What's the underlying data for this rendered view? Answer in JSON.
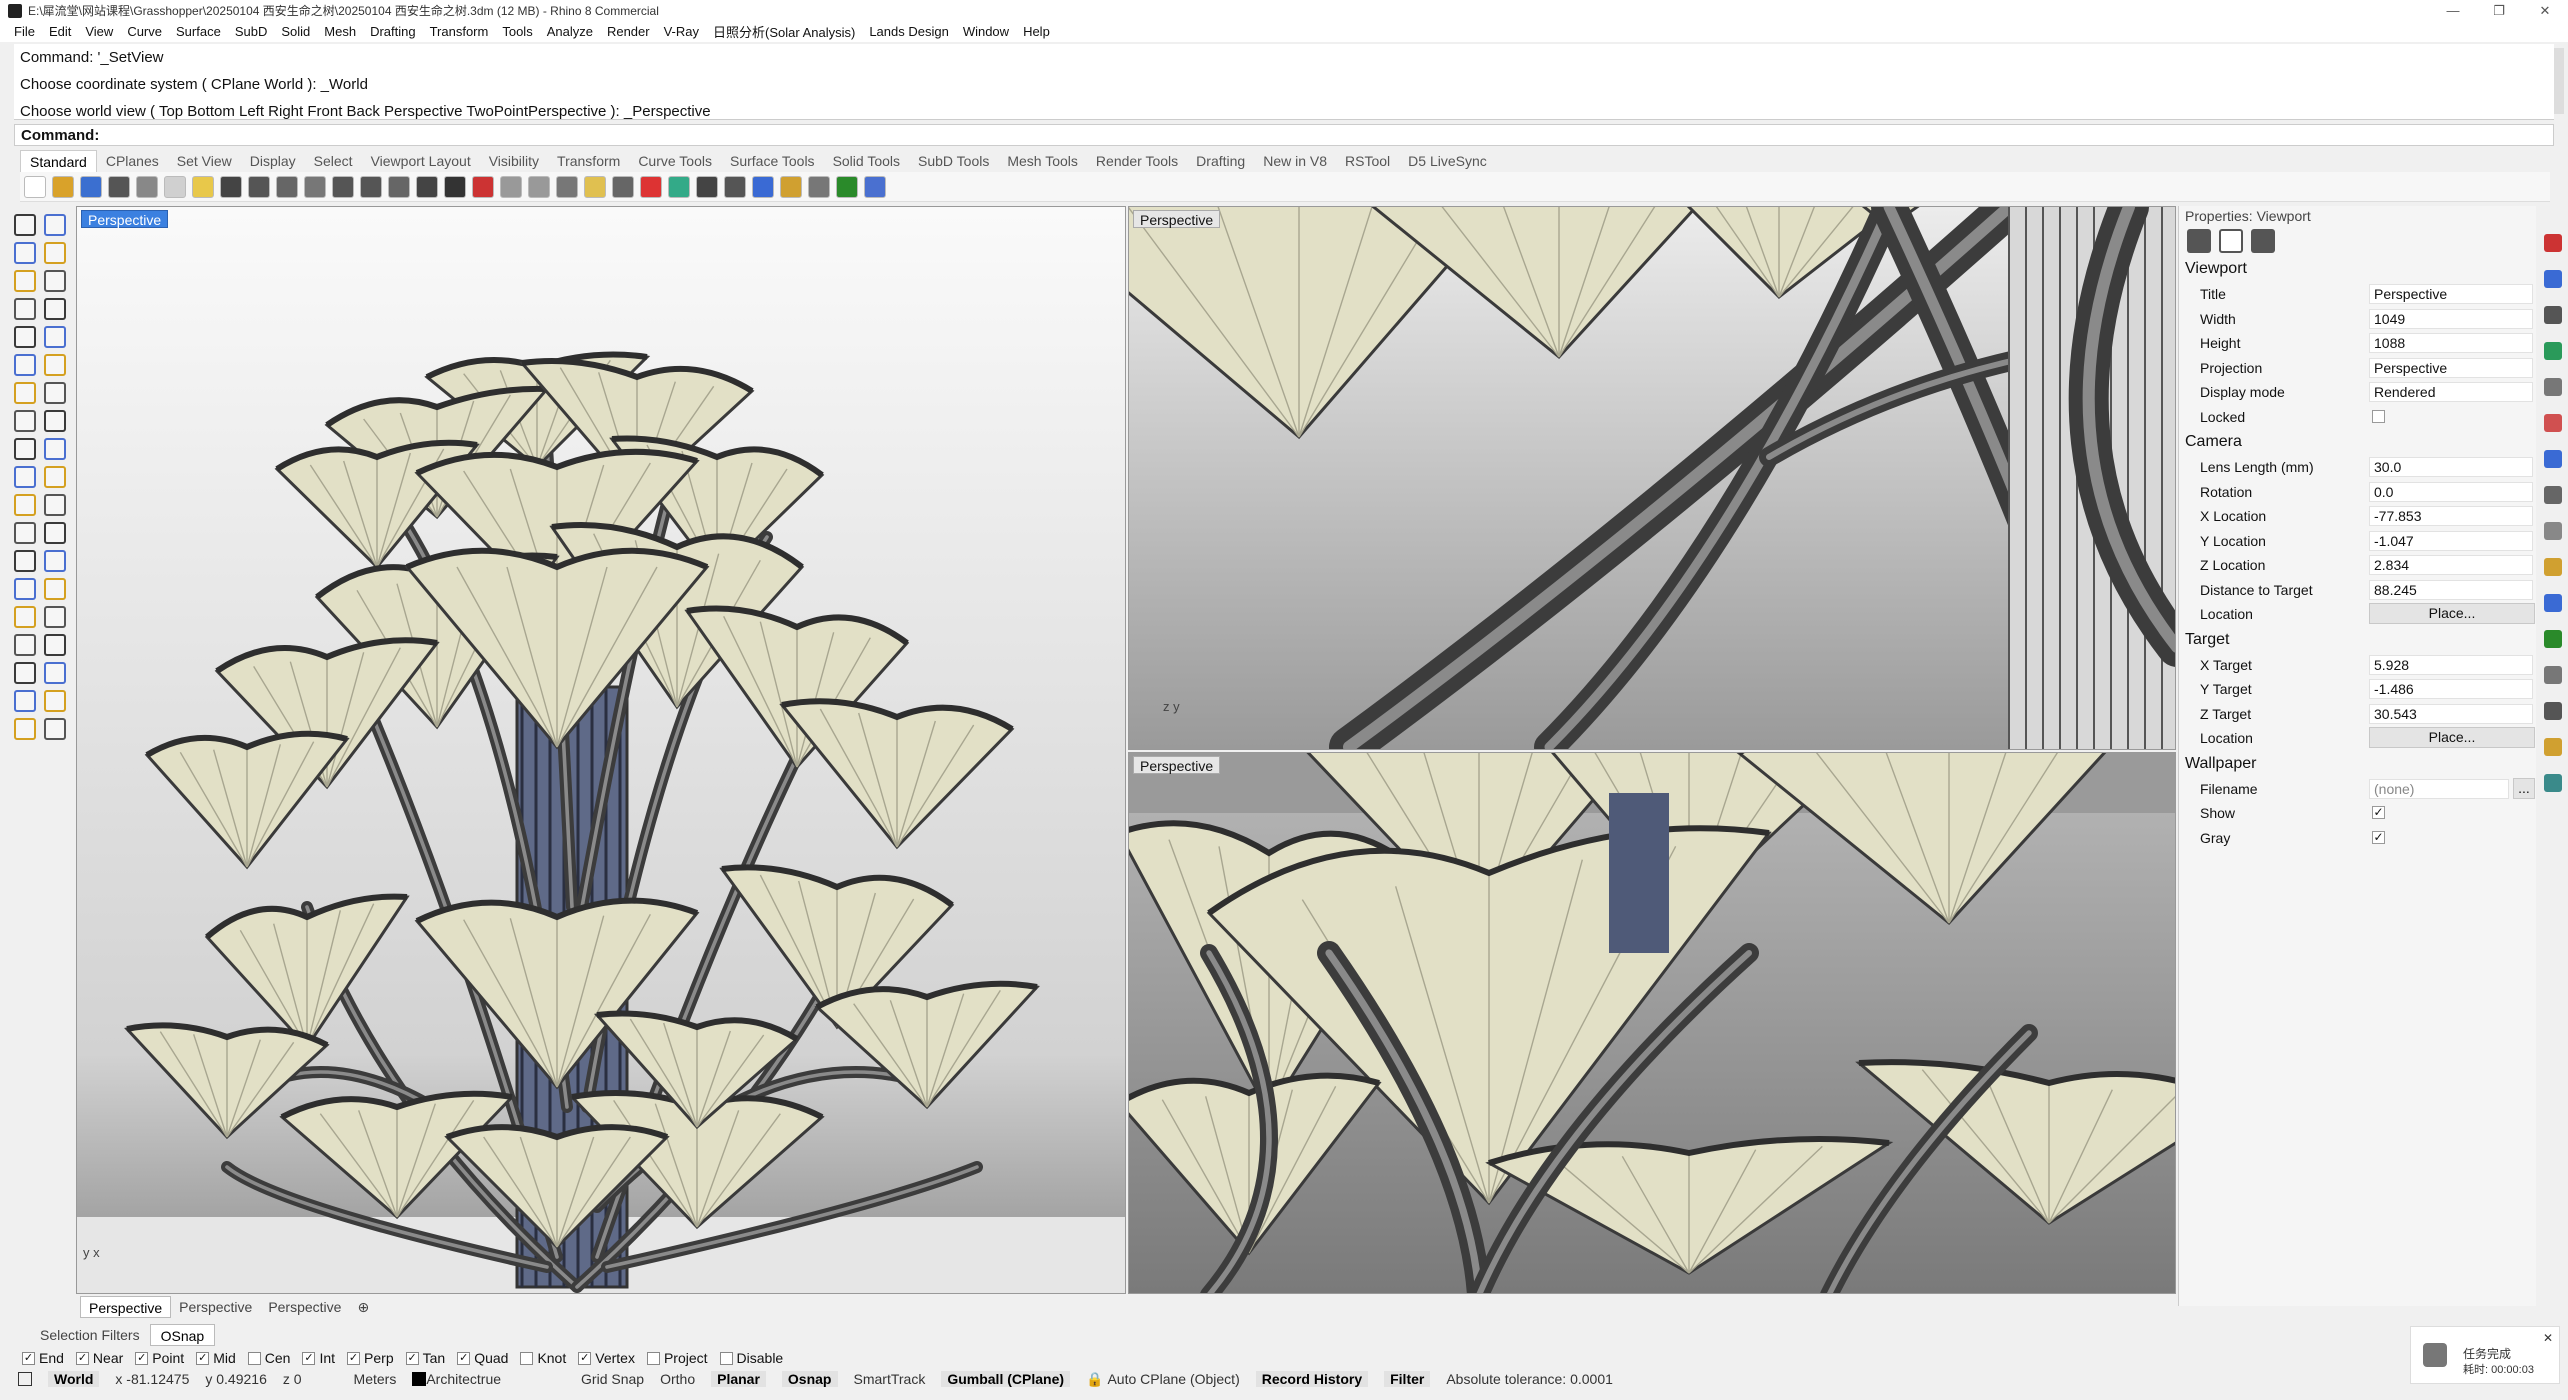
{
  "title": "E:\\犀流堂\\网站课程\\Grasshopper\\20250104 西安生命之树\\20250104 西安生命之树.3dm (12 MB) - Rhino 8 Commercial",
  "menu": [
    "File",
    "Edit",
    "View",
    "Curve",
    "Surface",
    "SubD",
    "Solid",
    "Mesh",
    "Drafting",
    "Transform",
    "Tools",
    "Analyze",
    "Render",
    "V-Ray",
    "日照分析(Solar Analysis)",
    "Lands Design",
    "Window",
    "Help"
  ],
  "command_history": [
    "Command: '_SetView",
    "Choose coordinate system ( CPlane  World ): _World",
    "Choose world view ( Top  Bottom  Left  Right  Front  Back  Perspective  TwoPointPerspective ): _Perspective"
  ],
  "command_prompt": "Command:",
  "toolbar_tabs": [
    "Standard",
    "CPlanes",
    "Set View",
    "Display",
    "Select",
    "Viewport Layout",
    "Visibility",
    "Transform",
    "Curve Tools",
    "Surface Tools",
    "Solid Tools",
    "SubD Tools",
    "Mesh Tools",
    "Render Tools",
    "Drafting",
    "New in V8",
    "RSTool",
    "D5 LiveSync"
  ],
  "viewports": {
    "main_label": "Perspective",
    "top_right_label": "Perspective",
    "bottom_right_label": "Perspective",
    "main_axis": "y x",
    "tr_axis": "z y"
  },
  "viewport_tabs": [
    "Perspective",
    "Perspective",
    "Perspective"
  ],
  "properties": {
    "title": "Properties: Viewport",
    "viewport_section": "Viewport",
    "rows_viewport": [
      {
        "k": "Title",
        "v": "Perspective"
      },
      {
        "k": "Width",
        "v": "1049"
      },
      {
        "k": "Height",
        "v": "1088"
      },
      {
        "k": "Projection",
        "v": "Perspective"
      },
      {
        "k": "Display mode",
        "v": "Rendered"
      }
    ],
    "locked_label": "Locked",
    "camera_section": "Camera",
    "rows_camera": [
      {
        "k": "Lens Length (mm)",
        "v": "30.0"
      },
      {
        "k": "Rotation",
        "v": "0.0"
      },
      {
        "k": "X Location",
        "v": "-77.853"
      },
      {
        "k": "Y Location",
        "v": "-1.047"
      },
      {
        "k": "Z Location",
        "v": "2.834"
      },
      {
        "k": "Distance to Target",
        "v": "88.245"
      }
    ],
    "location_label": "Location",
    "place_button": "Place...",
    "target_section": "Target",
    "rows_target": [
      {
        "k": "X Target",
        "v": "5.928"
      },
      {
        "k": "Y Target",
        "v": "-1.486"
      },
      {
        "k": "Z Target",
        "v": "30.543"
      }
    ],
    "wallpaper_section": "Wallpaper",
    "filename_label": "Filename",
    "filename_value": "(none)",
    "browse": "...",
    "show_label": "Show",
    "gray_label": "Gray",
    "check": "✓"
  },
  "filters": [
    "Selection Filters",
    "OSnap"
  ],
  "osnap": [
    {
      "label": "End",
      "checked": true
    },
    {
      "label": "Near",
      "checked": true
    },
    {
      "label": "Point",
      "checked": true
    },
    {
      "label": "Mid",
      "checked": true
    },
    {
      "label": "Cen",
      "checked": false
    },
    {
      "label": "Int",
      "checked": true
    },
    {
      "label": "Perp",
      "checked": true
    },
    {
      "label": "Tan",
      "checked": true
    },
    {
      "label": "Quad",
      "checked": true
    },
    {
      "label": "Knot",
      "checked": false
    },
    {
      "label": "Vertex",
      "checked": true
    },
    {
      "label": "Project",
      "checked": false
    },
    {
      "label": "Disable",
      "checked": false
    }
  ],
  "status": {
    "cplane": "World",
    "x": "x -81.12475",
    "y": "y 0.49216",
    "z": "z 0",
    "units": "Meters",
    "layer": "Architectrue",
    "grid_snap": "Grid Snap",
    "ortho": "Ortho",
    "planar": "Planar",
    "osnap": "Osnap",
    "smarttrack": "SmartTrack",
    "gumball": "Gumball (CPlane)",
    "auto_cplane": "Auto CPlane (Object)",
    "record_history": "Record History",
    "filter": "Filter",
    "tolerance": "Absolute tolerance: 0.0001"
  },
  "notification": {
    "line1": "任务完成",
    "line2": "耗时: 00:00:03"
  },
  "colors": {
    "accent": "#3b80e0",
    "canopy": "#e2e0c6",
    "structure": "#3a3a3a"
  }
}
